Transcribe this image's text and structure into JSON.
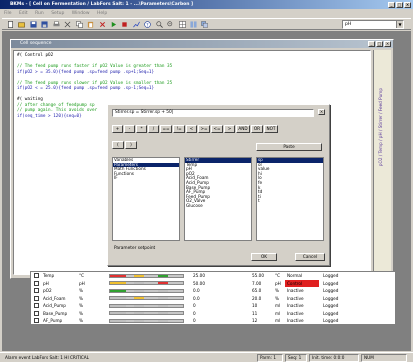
{
  "app": {
    "title": "BKMs - [ Cell on Fermentation / LabFors Salt: 1 - ...\\Parameters\\Carbon ]",
    "menu": [
      "File",
      "Edit",
      "Run",
      "Setup",
      "Window",
      "Help"
    ],
    "toolbar_combo": "pH"
  },
  "script_window": {
    "title": "Cell sequence",
    "lines": [
      {
        "text": "#( Control pO2",
        "color": "black"
      },
      {
        "text": "",
        "color": "black"
      },
      {
        "text": "// The feed pump runs faster if pO2 Value is greater than 35",
        "color": "green"
      },
      {
        "text": "if(pO2 > = 35.0){feed pump .sp=feed pump .sp+1;Seq=1}",
        "color": "blue"
      },
      {
        "text": "",
        "color": "black"
      },
      {
        "text": "// The feed pump runs slower if pO2 Value is smaller than 25",
        "color": "green"
      },
      {
        "text": "if(pO2 < = 25.0){feed pump .sp=feed pump .sp-1;Seq=1}",
        "color": "blue"
      },
      {
        "text": "",
        "color": "black"
      },
      {
        "text": "#( waiting",
        "color": "black"
      },
      {
        "text": "// after change of feedpump sp",
        "color": "green"
      },
      {
        "text": "// pump again. This avoids over",
        "color": "green"
      },
      {
        "text": "if(seq_time > 120){seq=0}",
        "color": "blue"
      }
    ],
    "side_labels": [
      "pO2",
      "Temp",
      "pH",
      "Stirrer",
      "Feed Pump"
    ]
  },
  "expression_dialog": {
    "expression_value": "Stirrer.sp = Stirrer.sp + 50|",
    "operator_buttons": [
      "+",
      "-",
      "*",
      "/",
      "==",
      "!=",
      "<",
      ">=",
      "<=",
      ">",
      "AND",
      "OR",
      "NOT"
    ],
    "paren_buttons": [
      "(",
      ")"
    ],
    "paste_label": "Paste",
    "categories": [
      "Variables",
      "Parameters",
      "Math Functions",
      "Functions",
      "IF"
    ],
    "selected_category": "Parameters",
    "parameters": [
      "Stirrer",
      "Temp",
      "pH",
      "pO2",
      "Acid_Foam",
      "Acid_Pump",
      "Base_Pump",
      "AF_Pump",
      "Feed_Pump",
      "O2_Valve",
      "Glucose"
    ],
    "selected_parameter": "Stirrer",
    "properties": [
      "sp",
      "ol",
      "value",
      "hi",
      "lo",
      "fe",
      "k",
      "td",
      "ti",
      "t"
    ],
    "selected_property": "sp",
    "status_label": "Parameter setpoint",
    "ok_label": "OK",
    "cancel_label": "Cancel"
  },
  "parameter_table": {
    "rows": [
      {
        "name": "Temp",
        "unit": "°C",
        "value": "25.00",
        "sp": "55.00",
        "unit2": "°C",
        "state": "Normal",
        "log": "Logged",
        "state_color": "#ffffff"
      },
      {
        "name": "pH",
        "unit": "pH",
        "value": "50.00",
        "sp": "7.00",
        "unit2": "pH",
        "state": "Control",
        "log": "Logged",
        "state_color": "#e02020"
      },
      {
        "name": "pO2",
        "unit": "%",
        "value": "0.0",
        "sp": "65.0",
        "unit2": "%",
        "state": "Inactive",
        "log": "Logged",
        "state_color": "#ffffff"
      },
      {
        "name": "Acid_Foam",
        "unit": "%",
        "value": "0.0",
        "sp": "20.0",
        "unit2": "%",
        "state": "Inactive",
        "log": "Logged",
        "state_color": "#ffffff"
      },
      {
        "name": "Acid_Pump",
        "unit": "%",
        "value": "0",
        "sp": "10",
        "unit2": "ml",
        "state": "Inactive",
        "log": "Logged",
        "state_color": "#ffffff"
      },
      {
        "name": "Base_Pump",
        "unit": "%",
        "value": "0",
        "sp": "11",
        "unit2": "ml",
        "state": "Inactive",
        "log": "Logged",
        "state_color": "#ffffff"
      },
      {
        "name": "AF_Pump",
        "unit": "%",
        "value": "0",
        "sp": "12",
        "unit2": "ml",
        "state": "Inactive",
        "log": "Logged",
        "state_color": "#ffffff"
      }
    ]
  },
  "statusbar": {
    "message": "Alarm event LabFors Salt: 1 HI CRITICAL",
    "parm": "Parm: 1",
    "seq": "Seq: 1",
    "time": "Init. time: 0:0:0",
    "mode": "NUM"
  }
}
